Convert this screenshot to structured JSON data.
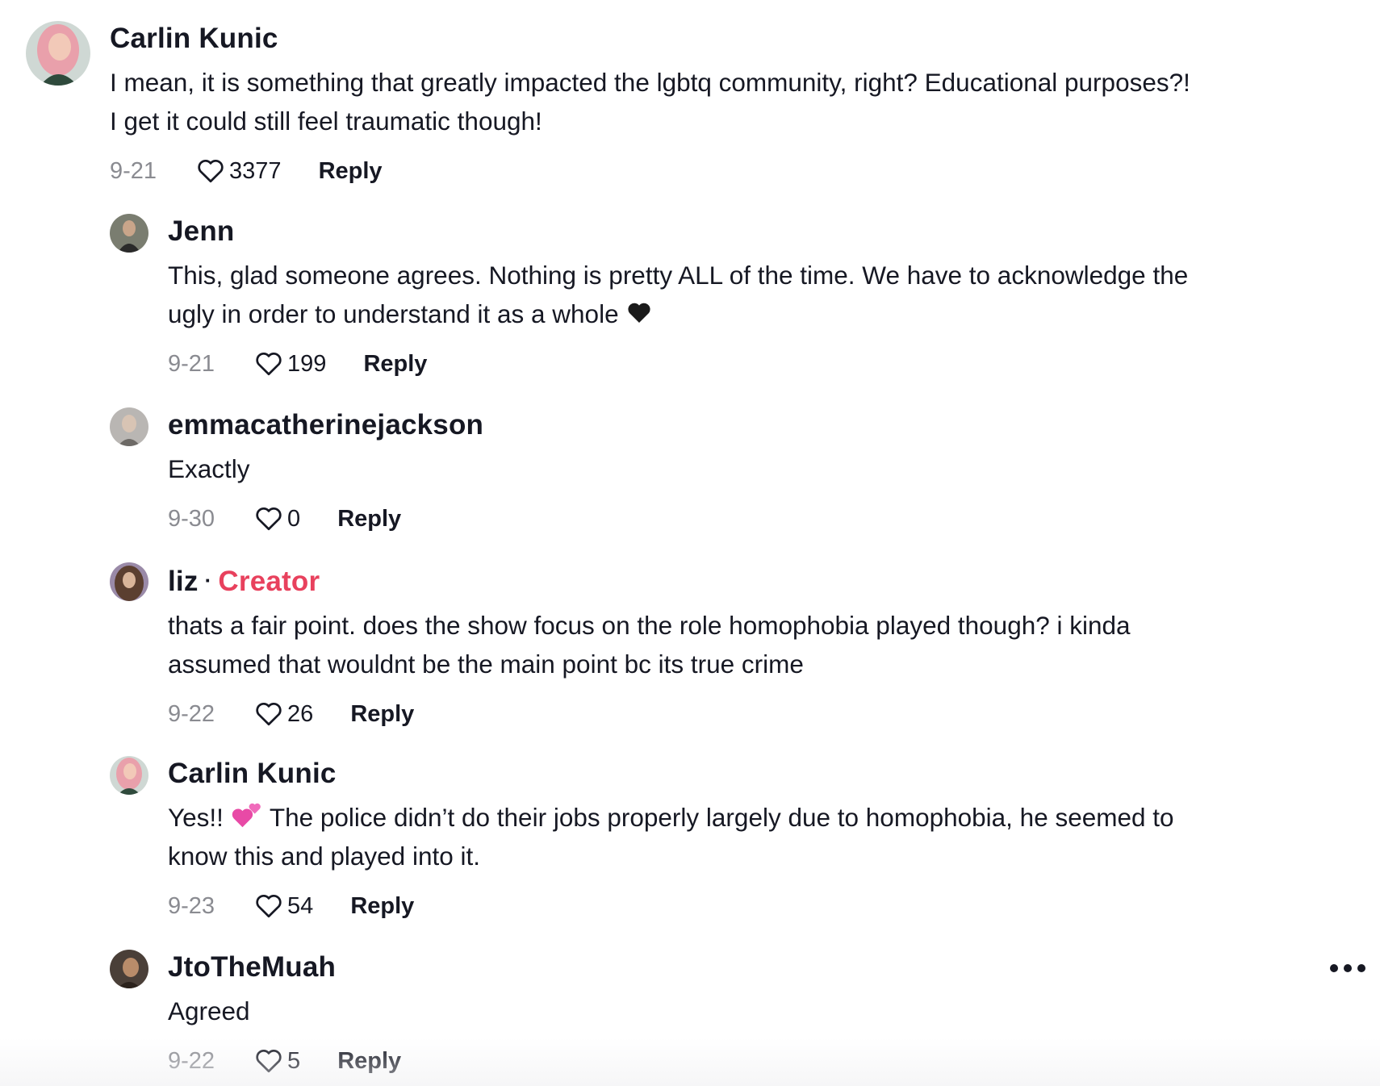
{
  "comments": [
    {
      "author": "Carlin Kunic",
      "text_lines": [
        "I mean, it is something that greatly impacted the lgbtq community, right? Educational purposes?!",
        "I get it could still feel traumatic though!"
      ],
      "date": "9-21",
      "likes": "3377",
      "reply_label": "Reply",
      "avatar_colors": [
        "#e9a0ab",
        "#2f4a3c"
      ]
    }
  ],
  "replies": [
    {
      "author": "Jenn",
      "text_lines": [
        "This, glad someone agrees. Nothing is pretty ALL of the time. We have to acknowledge the",
        "ugly in order to understand it as a whole"
      ],
      "trailing_emoji": "black-heart",
      "date": "9-21",
      "likes": "199",
      "reply_label": "Reply",
      "avatar_colors": [
        "#7a7d70",
        "#2a2a2a"
      ]
    },
    {
      "author": "emmacatherinejackson",
      "text_lines": [
        "Exactly"
      ],
      "date": "9-30",
      "likes": "0",
      "reply_label": "Reply",
      "avatar_colors": [
        "#b9b6b3",
        "#6d6a66"
      ]
    },
    {
      "author": "liz",
      "badge_separator": "·",
      "badge": "Creator",
      "badge_color": "#e8415d",
      "text_lines": [
        "thats a fair point. does the show focus on the role homophobia played though? i kinda",
        "assumed that wouldnt be the main point bc its true crime"
      ],
      "date": "9-22",
      "likes": "26",
      "reply_label": "Reply",
      "avatar_colors": [
        "#8a6a5a",
        "#3b2a22"
      ]
    },
    {
      "author": "Carlin Kunic",
      "text_prefix": "Yes!!",
      "leading_emoji": "two-hearts",
      "text_lines": [
        "The police didn’t do their jobs properly largely due to homophobia, he seemed to",
        "know this and played into it."
      ],
      "date": "9-23",
      "likes": "54",
      "reply_label": "Reply",
      "avatar_colors": [
        "#e9a0ab",
        "#2f4a3c"
      ]
    },
    {
      "author": "JtoTheMuah",
      "text_lines": [
        "Agreed"
      ],
      "date": "9-22",
      "likes": "5",
      "reply_label": "Reply",
      "avatar_colors": [
        "#9a7a5a",
        "#2b221c"
      ]
    }
  ],
  "more_options_label": "more-options"
}
